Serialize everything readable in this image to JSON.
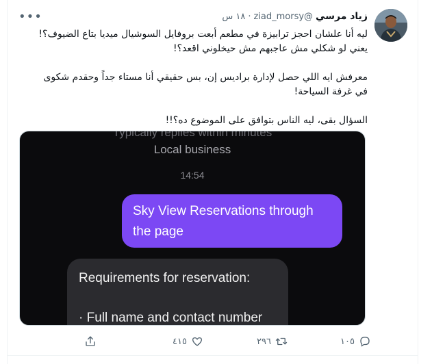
{
  "tweet": {
    "display_name": "زياد مرسي",
    "handle": "@ziad_morsy",
    "separator": "·",
    "time": "١٨ س",
    "more_icon": "more-dots-icon",
    "body_paragraphs": [
      "ليه أنا علشان احجز ترابيزة في مطعم أبعت بروفايل السوشيال ميديا بتاع الضيوف؟!\nيعني لو شكلي مش عاجبهم مش حيخلوني اقعد؟!",
      "معرفش ايه اللي حصل لإدارة براديس إن، بس حقيقي أنا مستاء جداً وحقدم شكوى\nفي غرفة السياحة!",
      "السؤال بقى، ليه الناس بتوافق على الموضوع ده؟!!"
    ]
  },
  "media": {
    "cut_line": "Typically replies within minutes",
    "subtitle": "Local business",
    "time": "14:54",
    "outgoing_message": "Sky View Reservations through the page",
    "incoming_heading": "Requirements for reservation:",
    "incoming_item": "· Full name and contact number"
  },
  "actions": {
    "reply_count": "١٠٥",
    "retweet_count": "٢٩٦",
    "like_count": "٤١٥",
    "reply_icon": "reply-icon",
    "retweet_icon": "retweet-icon",
    "like_icon": "heart-icon",
    "share_icon": "share-icon"
  },
  "colors": {
    "accent_purple": "#7c48f4",
    "muted_text": "#536471",
    "media_background": "#0b0b0d"
  }
}
